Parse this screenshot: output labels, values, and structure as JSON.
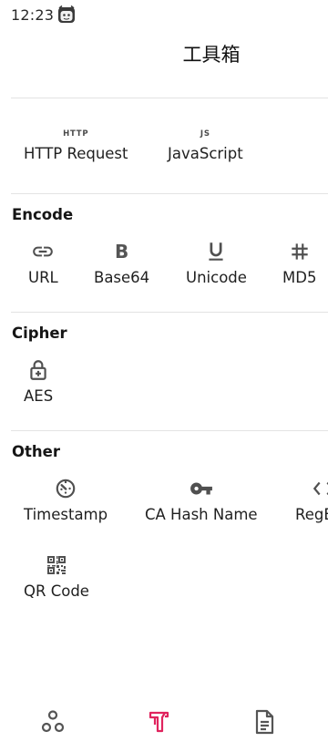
{
  "status": {
    "time": "12:23"
  },
  "header": {
    "title": "工具箱"
  },
  "network": {
    "tools": [
      {
        "icon": "http-icon",
        "glyph": "HTTP",
        "label": "HTTP Request"
      },
      {
        "icon": "js-icon",
        "glyph": "JS",
        "label": "JavaScript"
      }
    ]
  },
  "encode": {
    "title": "Encode",
    "tools": [
      {
        "icon": "link-icon",
        "label": "URL"
      },
      {
        "icon": "bold-b-icon",
        "glyph": "B",
        "label": "Base64"
      },
      {
        "icon": "underline-u-icon",
        "label": "Unicode"
      },
      {
        "icon": "hash-icon",
        "label": "MD5"
      }
    ]
  },
  "cipher": {
    "title": "Cipher",
    "tools": [
      {
        "icon": "lock-plus-icon",
        "label": "AES"
      }
    ]
  },
  "other": {
    "title": "Other",
    "tools": [
      {
        "icon": "timer-icon",
        "label": "Timestamp"
      },
      {
        "icon": "key-icon",
        "label": "CA Hash Name"
      },
      {
        "icon": "code-brackets-icon",
        "label": "RegEx"
      },
      {
        "icon": "qr-code-icon",
        "label": "QR Code"
      }
    ]
  },
  "bottom_nav": {
    "items": [
      {
        "icon": "bubbles-icon"
      },
      {
        "icon": "toolbox-icon",
        "active": true
      },
      {
        "icon": "document-icon"
      }
    ],
    "active_color": "#e0245e",
    "inactive_color": "#555555"
  }
}
